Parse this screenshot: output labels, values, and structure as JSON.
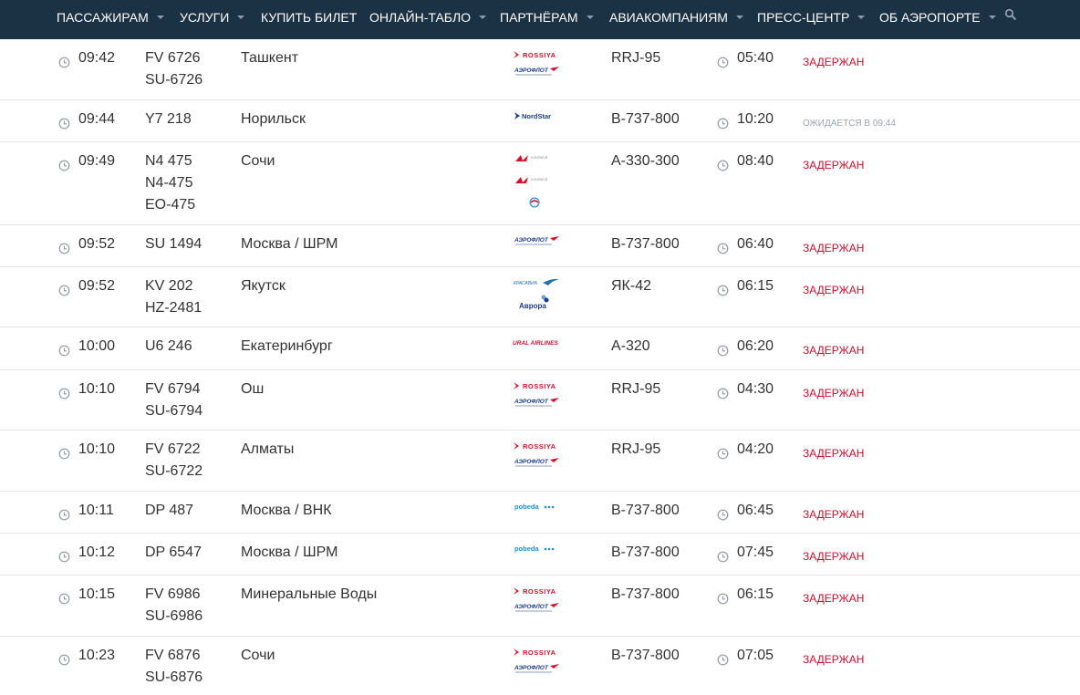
{
  "nav": {
    "items": [
      {
        "label": "ПАССАЖИРАМ",
        "caret": true
      },
      {
        "label": "УСЛУГИ",
        "caret": true
      },
      {
        "label": "КУПИТЬ БИЛЕТ",
        "caret": false
      },
      {
        "label": "ОНЛАЙН-ТАБЛО",
        "caret": true
      },
      {
        "label": "ПАРТНЁРАМ",
        "caret": true
      },
      {
        "label": "АВИАКОМПАНИЯМ",
        "caret": true
      },
      {
        "label": "ПРЕСС-ЦЕНТР",
        "caret": true
      },
      {
        "label": "ОБ АЭРОПОРТЕ",
        "caret": true
      }
    ],
    "search_icon": "search-icon"
  },
  "colors": {
    "navbar_bg": "#1b3144",
    "status_delayed": "#c8102e",
    "status_expected": "#9aa4ad",
    "divider": "#e6e6e6"
  },
  "flights": [
    {
      "time": "09:42",
      "flights": [
        "FV 6726",
        "SU-6726"
      ],
      "destination": "Ташкент",
      "airlines": [
        "rossiya",
        "aeroflot"
      ],
      "aircraft": "RRJ-95",
      "departure": "05:40",
      "status": "ЗАДЕРЖАН",
      "status_type": "delayed"
    },
    {
      "time": "09:44",
      "flights": [
        "Y7 218"
      ],
      "destination": "Норильск",
      "airlines": [
        "nordstar"
      ],
      "aircraft": "B-737-800",
      "departure": "10:20",
      "status": "ОЖИДАЕТСЯ В 09:44",
      "status_type": "expected"
    },
    {
      "time": "09:49",
      "flights": [
        "N4 475",
        "N4-475",
        "EO-475"
      ],
      "destination": "Сочи",
      "airlines": [
        "nordwind",
        "nordwind",
        "pegas"
      ],
      "aircraft": "A-330-300",
      "departure": "08:40",
      "status": "ЗАДЕРЖАН",
      "status_type": "delayed"
    },
    {
      "time": "09:52",
      "flights": [
        "SU 1494"
      ],
      "destination": "Москва / ШРМ",
      "airlines": [
        "aeroflot"
      ],
      "aircraft": "B-737-800",
      "departure": "06:40",
      "status": "ЗАДЕРЖАН",
      "status_type": "delayed"
    },
    {
      "time": "09:52",
      "flights": [
        "KV 202",
        "HZ-2481"
      ],
      "destination": "Якутск",
      "airlines": [
        "krasavia",
        "aurora"
      ],
      "aircraft": "ЯК-42",
      "departure": "06:15",
      "status": "ЗАДЕРЖАН",
      "status_type": "delayed"
    },
    {
      "time": "10:00",
      "flights": [
        "U6 246"
      ],
      "destination": "Екатеринбург",
      "airlines": [
        "ural"
      ],
      "aircraft": "A-320",
      "departure": "06:20",
      "status": "ЗАДЕРЖАН",
      "status_type": "delayed"
    },
    {
      "time": "10:10",
      "flights": [
        "FV 6794",
        "SU-6794"
      ],
      "destination": "Ош",
      "airlines": [
        "rossiya",
        "aeroflot"
      ],
      "aircraft": "RRJ-95",
      "departure": "04:30",
      "status": "ЗАДЕРЖАН",
      "status_type": "delayed"
    },
    {
      "time": "10:10",
      "flights": [
        "FV 6722",
        "SU-6722"
      ],
      "destination": "Алматы",
      "airlines": [
        "rossiya",
        "aeroflot"
      ],
      "aircraft": "RRJ-95",
      "departure": "04:20",
      "status": "ЗАДЕРЖАН",
      "status_type": "delayed"
    },
    {
      "time": "10:11",
      "flights": [
        "DP 487"
      ],
      "destination": "Москва / ВНК",
      "airlines": [
        "pobeda"
      ],
      "aircraft": "B-737-800",
      "departure": "06:45",
      "status": "ЗАДЕРЖАН",
      "status_type": "delayed"
    },
    {
      "time": "10:12",
      "flights": [
        "DP 6547"
      ],
      "destination": "Москва / ШРМ",
      "airlines": [
        "pobeda"
      ],
      "aircraft": "B-737-800",
      "departure": "07:45",
      "status": "ЗАДЕРЖАН",
      "status_type": "delayed"
    },
    {
      "time": "10:15",
      "flights": [
        "FV 6986",
        "SU-6986"
      ],
      "destination": "Минеральные Воды",
      "airlines": [
        "rossiya",
        "aeroflot"
      ],
      "aircraft": "B-737-800",
      "departure": "06:15",
      "status": "ЗАДЕРЖАН",
      "status_type": "delayed"
    },
    {
      "time": "10:23",
      "flights": [
        "FV 6876",
        "SU-6876"
      ],
      "destination": "Сочи",
      "airlines": [
        "rossiya",
        "aeroflot"
      ],
      "aircraft": "B-737-800",
      "departure": "07:05",
      "status": "ЗАДЕРЖАН",
      "status_type": "delayed"
    }
  ],
  "logo_text": {
    "rossiya": "ROSSIYA",
    "aeroflot": "АЭРОФЛОТ",
    "nordstar": "NordStar",
    "nordwind": "nordwind",
    "krasavia": "КРАСАВИА",
    "aurora": "Аврора",
    "ural": "URAL AIRLINES",
    "pobeda": "pobeda"
  }
}
